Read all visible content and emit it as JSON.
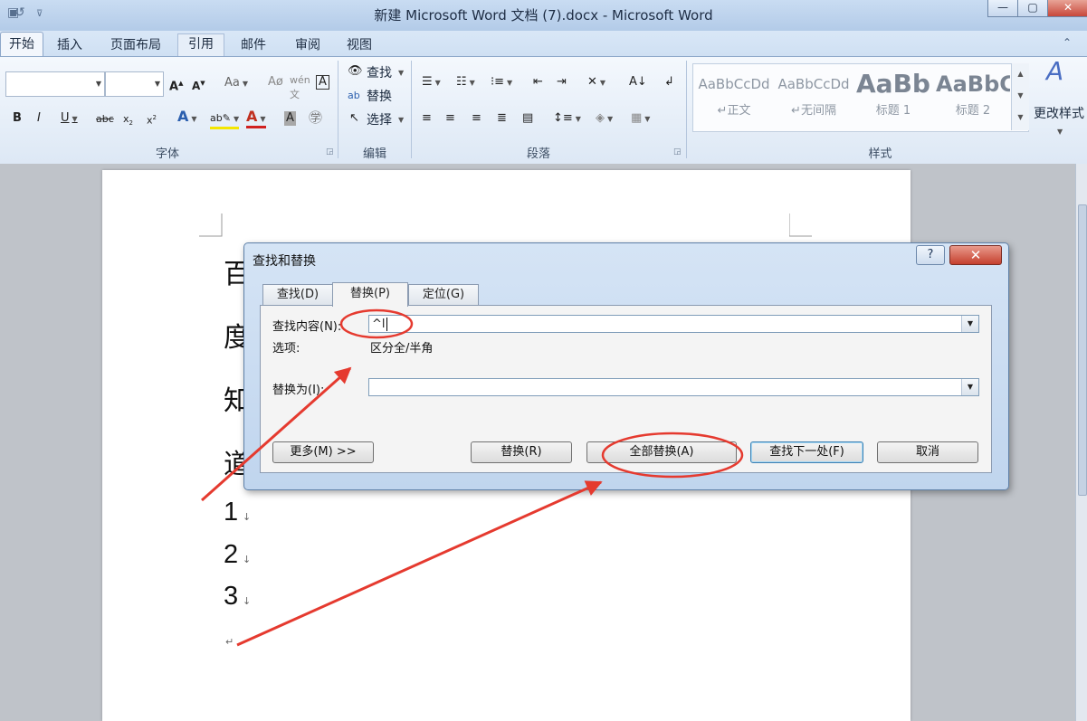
{
  "window": {
    "title": "新建 Microsoft Word 文档 (7).docx - Microsoft Word",
    "undo_glyph": "↺",
    "customize_glyph": "⊽",
    "minimize_glyph": "—",
    "maximize_glyph": "▢"
  },
  "ribbon": {
    "tabs": [
      "开始",
      "插入",
      "页面布局",
      "引用",
      "邮件",
      "审阅",
      "视图"
    ],
    "active_tab": "开始",
    "groups": {
      "font": "字体",
      "editing": "编辑",
      "paragraph": "段落",
      "styles": "样式"
    },
    "editing": {
      "find": "查找",
      "replace": "替换",
      "select": "选择"
    },
    "styles_gallery": [
      {
        "sample": "AaBbCcDd",
        "label": "↵正文"
      },
      {
        "sample": "AaBbCcDd",
        "label": "↵无间隔"
      },
      {
        "sample": "AaBb",
        "label": "标题 1"
      },
      {
        "sample": "AaBbC",
        "label": "标题 2"
      }
    ],
    "change_styles": "更改样式"
  },
  "document": {
    "chars": [
      "百",
      "度",
      "知",
      "道"
    ],
    "numbered_lines": [
      "1",
      "2",
      "3"
    ],
    "paragraph_mark": "↵",
    "line_break_mark": "↓"
  },
  "dialog": {
    "title": "查找和替换",
    "help": "?",
    "close": "✕",
    "tabs": [
      "查找(D)",
      "替换(P)",
      "定位(G)"
    ],
    "active_tab": "替换(P)",
    "find_label": "查找内容(N):",
    "find_value": "^l",
    "options_label": "选项:",
    "options_value": "区分全/半角",
    "replace_label": "替换为(I):",
    "replace_value": "",
    "buttons": {
      "more": "更多(M) >>",
      "replace": "替换(R)",
      "replace_all": "全部替换(A)",
      "find_next": "查找下一处(F)",
      "cancel": "取消"
    }
  },
  "annotations": {
    "color": "#e53a2f"
  }
}
